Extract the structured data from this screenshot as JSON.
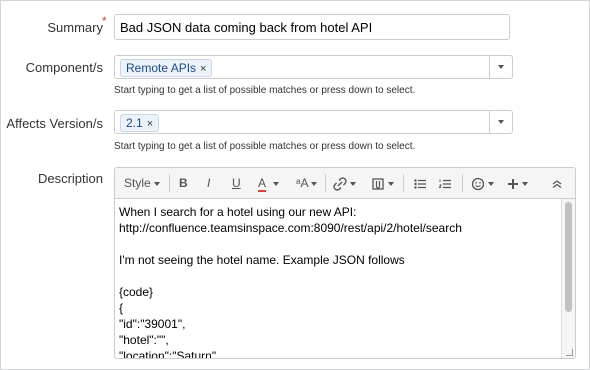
{
  "fields": {
    "summary": {
      "label": "Summary",
      "required_marker": "*",
      "value": "Bad JSON data coming back from hotel API"
    },
    "components": {
      "label": "Component/s",
      "pills": [
        "Remote APIs"
      ],
      "remove_glyph": "×",
      "hint": "Start typing to get a list of possible matches or press down to select."
    },
    "affects_version": {
      "label": "Affects Version/s",
      "pills": [
        "2.1"
      ],
      "remove_glyph": "×",
      "hint": "Start typing to get a list of possible matches or press down to select."
    },
    "description": {
      "label": "Description"
    }
  },
  "toolbar": {
    "style_label": "Style",
    "bold": "B",
    "italic": "I",
    "underline": "U",
    "text_color": "A",
    "text_color_underline": "#d04437",
    "more_formatting": "ᵃA"
  },
  "editor": {
    "lines": [
      "When I search for a hotel using our new API:",
      "http://confluence.teamsinspace.com:8090/rest/api/2/hotel/search",
      "",
      "I'm not seeing the hotel name. Example JSON follows",
      "",
      "{code}",
      "{",
      "\"id\":\"39001\",",
      "\"hotel\":\"\",",
      "\"location\":\"Saturn\""
    ]
  }
}
